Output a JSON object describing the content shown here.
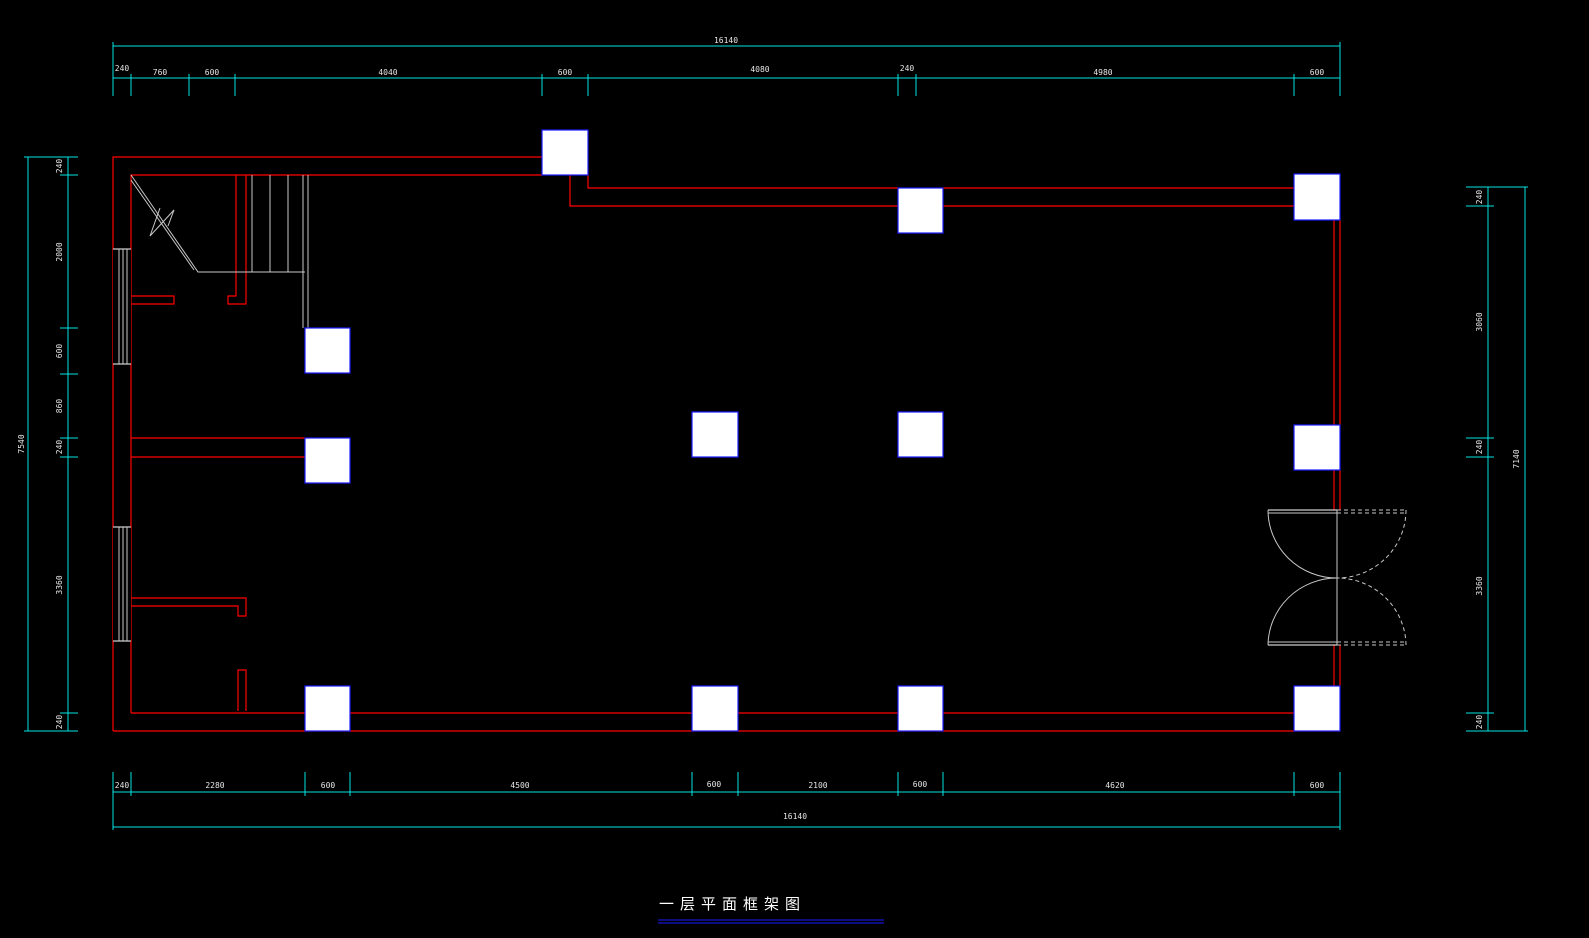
{
  "title": "一层平面框架图",
  "dimensions": {
    "top_total": "16140",
    "top_segments": [
      "240",
      "760",
      "600",
      "4040",
      "600",
      "4080",
      "240",
      "4980",
      "600"
    ],
    "bottom_total": "16140",
    "bottom_segments": [
      "240",
      "2280",
      "600",
      "4500",
      "600",
      "2100",
      "600",
      "4620",
      "600"
    ],
    "left_total": "7540",
    "left_segments": [
      "240",
      "2000",
      "600",
      "860",
      "240",
      "3360",
      "240"
    ],
    "right_total": "7140",
    "right_segments": [
      "240",
      "3060",
      "240",
      "3360",
      "240"
    ]
  },
  "colors": {
    "background": "#000000",
    "walls": "#ff0000",
    "dimensions": "#00e5e5",
    "columns": "#ffffff",
    "column_outline": "#1a1aff",
    "title_underline": "#1a1aff"
  }
}
